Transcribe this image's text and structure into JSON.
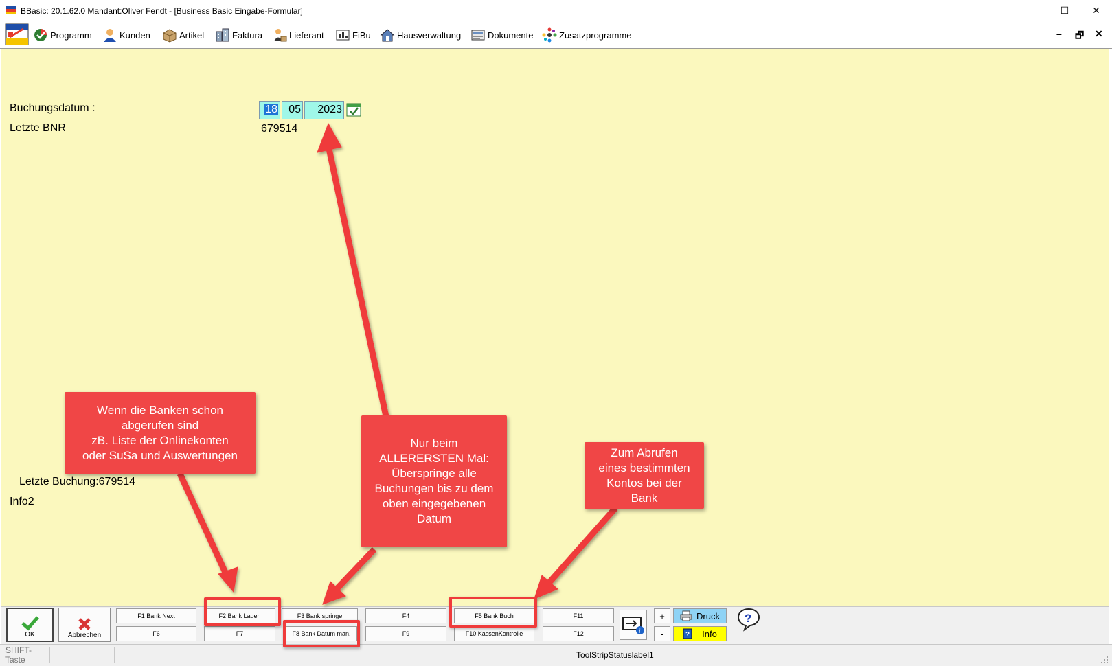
{
  "window": {
    "title": "BBasic: 20.1.62.0 Mandant:Oliver Fendt  - [Business Basic Eingabe-Formular]",
    "minimize": "—",
    "maximize": "☐",
    "close": "✕"
  },
  "menu": {
    "items": [
      {
        "label": "Programm",
        "icon": "programm-icon"
      },
      {
        "label": "Kunden",
        "icon": "kunden-icon"
      },
      {
        "label": "Artikel",
        "icon": "artikel-icon"
      },
      {
        "label": "Faktura",
        "icon": "faktura-icon"
      },
      {
        "label": "Lieferant",
        "icon": "lieferant-icon"
      },
      {
        "label": "FiBu",
        "icon": "fibu-icon"
      },
      {
        "label": "Hausverwaltung",
        "icon": "hausverwaltung-icon"
      },
      {
        "label": "Dokumente",
        "icon": "dokumente-icon"
      },
      {
        "label": "Zusatzprogramme",
        "icon": "zusatzprogramme-icon"
      }
    ],
    "mdi_minimize": "–",
    "mdi_restore": "🗗",
    "mdi_close": "✕"
  },
  "form": {
    "buchungsdatum_label": "Buchungsdatum :",
    "letzte_bnr_label": "Letzte BNR",
    "date_day": "18",
    "date_month": "05",
    "date_year": "2023",
    "letzte_bnr_value": "679514",
    "letzte_buchung": "Letzte Buchung:679514",
    "info2": "Info2"
  },
  "annotations": {
    "banken": "Wenn die Banken schon\nabgerufen sind\nzB. Liste der Onlinekonten\noder SuSa und Auswertungen",
    "erstes_mal": "Nur beim\nALLERERSTEN Mal:\nÜberspringe alle\nBuchungen bis zu dem\noben eingegebenen\nDatum",
    "abrufen": "Zum Abrufen\neines bestimmten\nKontos bei der\nBank"
  },
  "toolbar": {
    "ok_label": "OK",
    "cancel_label": "Abbrechen",
    "f1": "F1 Bank Next",
    "f2": "F2 Bank Laden",
    "f3": "F3 Bank springe",
    "f4": "F4",
    "f5": "F5 Bank Buch",
    "f11": "F11",
    "f6": "F6",
    "f7": "F7",
    "f8": "F8 Bank Datum man.",
    "f9": "F9",
    "f10": "F10 KassenKontrolle",
    "f12": "F12",
    "plus": "+",
    "minus": "-",
    "druck": "Druck",
    "info": "Info",
    "colors": {
      "druck_bg": "#8fd3f5",
      "info_bg": "#ffff00"
    }
  },
  "statusbar": {
    "shift": "SHIFT-Taste",
    "label1": "ToolStripStatuslabel1"
  },
  "colors": {
    "form_bg": "#fbf8be",
    "date_bg": "#9ff7e8",
    "callout_bg": "#f04646",
    "frame": "#ef3b3b"
  }
}
